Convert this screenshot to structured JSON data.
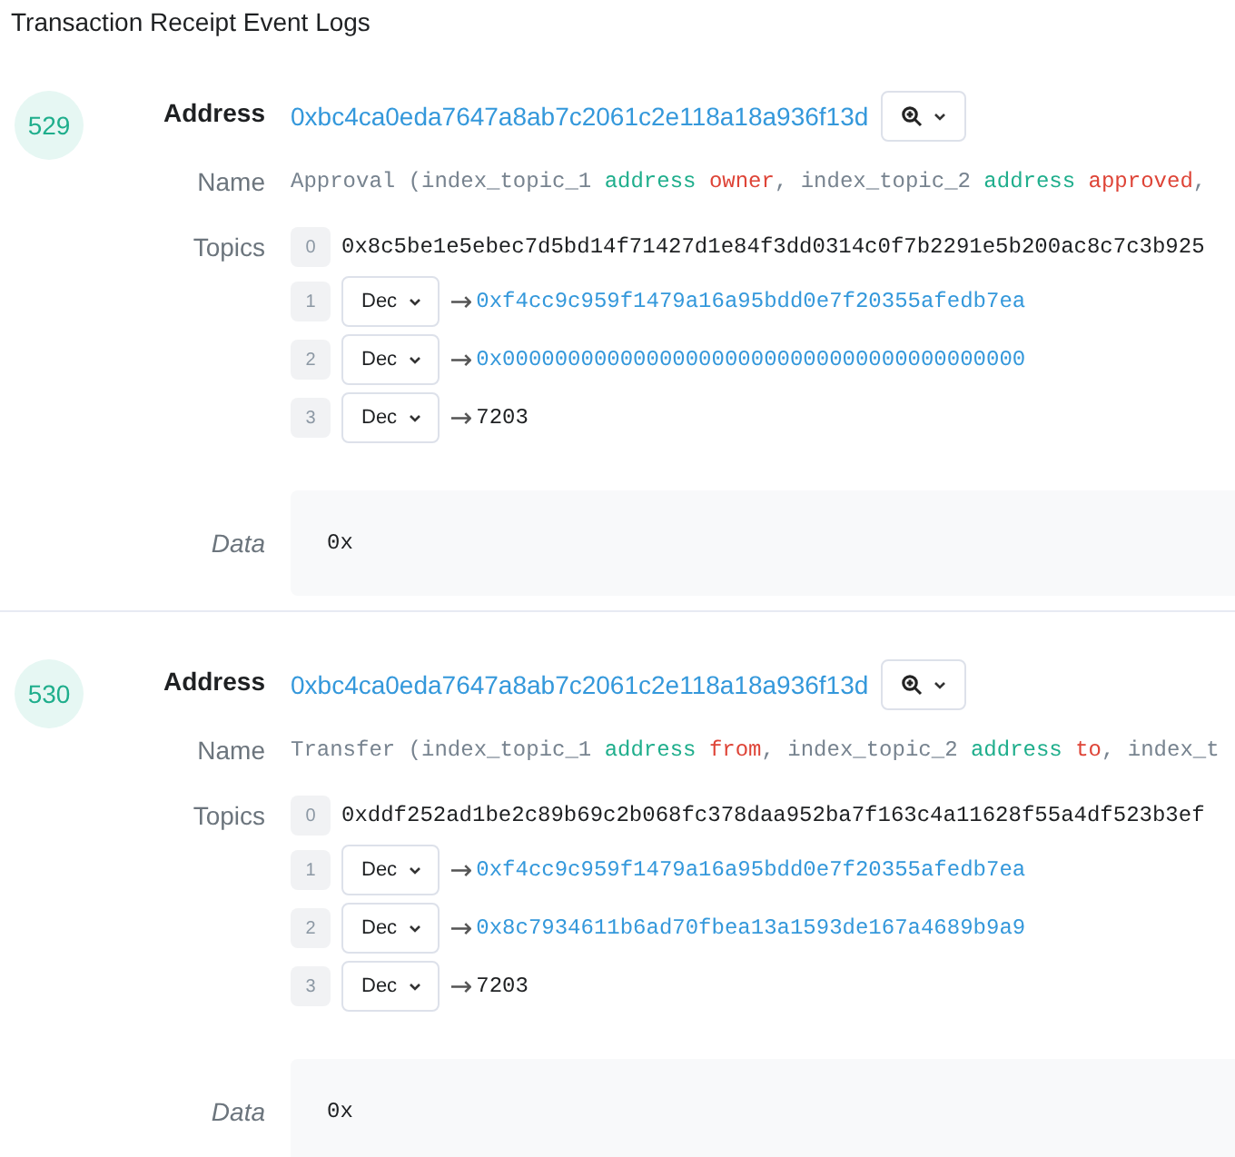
{
  "title": "Transaction Receipt Event Logs",
  "logs": [
    {
      "index": "529",
      "address_label": "Address",
      "address": "0xbc4ca0eda7647a8ab7c2061c2e118a18a936f13d",
      "name_label": "Name",
      "name_parts": [
        {
          "kind": "plain",
          "text": "Approval (index_topic_1 "
        },
        {
          "kind": "type",
          "text": "address"
        },
        {
          "kind": "param",
          "text": "owner"
        },
        {
          "kind": "plain",
          "text": ", index_topic_2 "
        },
        {
          "kind": "type",
          "text": "address"
        },
        {
          "kind": "param",
          "text": "approved"
        },
        {
          "kind": "plain",
          "text": ", "
        }
      ],
      "topics_label": "Topics",
      "topics": [
        {
          "index": "0",
          "kind": "raw",
          "value": "0x8c5be1e5ebec7d5bd14f71427d1e84f3dd0314c0f7b2291e5b200ac8c7c3b925"
        },
        {
          "index": "1",
          "kind": "decoded",
          "format": "Dec",
          "arrow": "→",
          "value": "0xf4cc9c959f1479a16a95bdd0e7f20355afedb7ea",
          "link": true
        },
        {
          "index": "2",
          "kind": "decoded",
          "format": "Dec",
          "arrow": "→",
          "value": "0x0000000000000000000000000000000000000000",
          "link": true
        },
        {
          "index": "3",
          "kind": "decoded",
          "format": "Dec",
          "arrow": "→",
          "value": "7203",
          "link": false
        }
      ],
      "data_label": "Data",
      "data": "0x"
    },
    {
      "index": "530",
      "address_label": "Address",
      "address": "0xbc4ca0eda7647a8ab7c2061c2e118a18a936f13d",
      "name_label": "Name",
      "name_parts": [
        {
          "kind": "plain",
          "text": "Transfer (index_topic_1 "
        },
        {
          "kind": "type",
          "text": "address"
        },
        {
          "kind": "param",
          "text": "from"
        },
        {
          "kind": "plain",
          "text": ", index_topic_2 "
        },
        {
          "kind": "type",
          "text": "address"
        },
        {
          "kind": "param",
          "text": "to"
        },
        {
          "kind": "plain",
          "text": ", index_t"
        }
      ],
      "topics_label": "Topics",
      "topics": [
        {
          "index": "0",
          "kind": "raw",
          "value": "0xddf252ad1be2c89b69c2b068fc378daa952ba7f163c4a11628f55a4df523b3ef"
        },
        {
          "index": "1",
          "kind": "decoded",
          "format": "Dec",
          "arrow": "→",
          "value": "0xf4cc9c959f1479a16a95bdd0e7f20355afedb7ea",
          "link": true
        },
        {
          "index": "2",
          "kind": "decoded",
          "format": "Dec",
          "arrow": "→",
          "value": "0x8c7934611b6ad70fbea13a1593de167a4689b9a9",
          "link": true
        },
        {
          "index": "3",
          "kind": "decoded",
          "format": "Dec",
          "arrow": "→",
          "value": "7203",
          "link": false
        }
      ],
      "data_label": "Data",
      "data": "0x"
    }
  ]
}
